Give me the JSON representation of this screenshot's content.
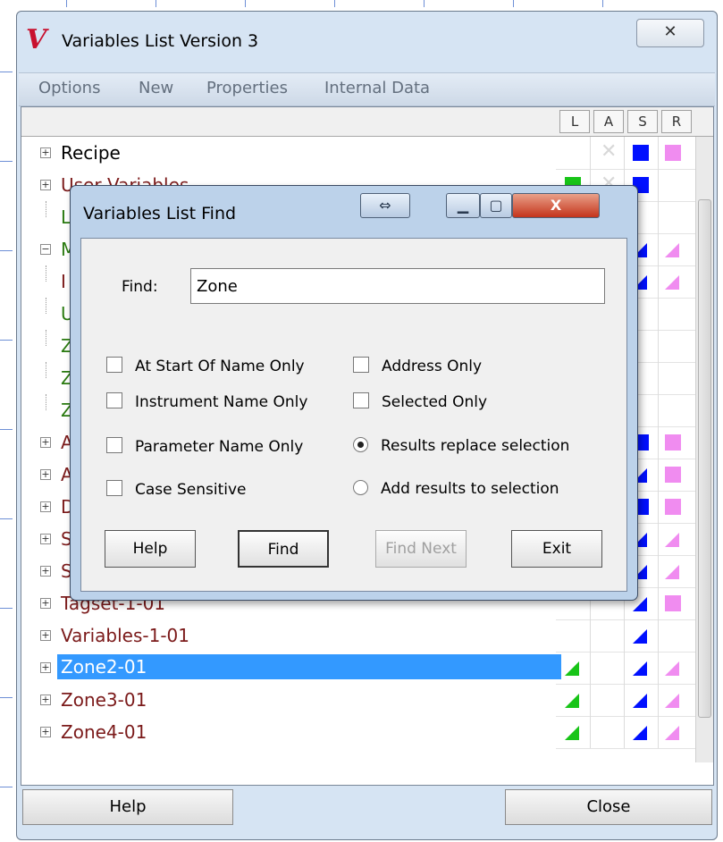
{
  "window": {
    "title": "Variables List Version 3",
    "logo": "V",
    "close_glyph": "✕"
  },
  "menu": [
    "Options",
    "New",
    "Properties",
    "Internal Data"
  ],
  "columns": [
    "L",
    "A",
    "S",
    "R"
  ],
  "tree_rows": [
    {
      "label": "Recipe",
      "color": "#000000"
    },
    {
      "label": "User Variables",
      "color": "#7b1a1a"
    },
    {
      "label": "L",
      "color": "#2a7a10"
    },
    {
      "label": "M",
      "color": "#2a7a10"
    },
    {
      "label": "I",
      "color": "#7b1a1a"
    },
    {
      "label": "U",
      "color": "#2a7a10"
    },
    {
      "label": "Z",
      "color": "#2a7a10"
    },
    {
      "label": "Z",
      "color": "#2a7a10"
    },
    {
      "label": "Z",
      "color": "#2a7a10"
    },
    {
      "label": "A",
      "color": "#7b1a1a"
    },
    {
      "label": "A",
      "color": "#7b1a1a"
    },
    {
      "label": "D",
      "color": "#7b1a1a"
    },
    {
      "label": "S",
      "color": "#7b1a1a"
    },
    {
      "label": "S",
      "color": "#7b1a1a"
    },
    {
      "label": "Tagset-1-01",
      "color": "#7b1a1a"
    },
    {
      "label": "Variables-1-01",
      "color": "#7b1a1a"
    },
    {
      "label": "Zone2-01",
      "color": "#ffffff"
    },
    {
      "label": "Zone3-01",
      "color": "#7b1a1a"
    },
    {
      "label": "Zone4-01",
      "color": "#7b1a1a"
    }
  ],
  "colors": {
    "blue": "#0010ff",
    "pink": "#f08cf0",
    "green": "#18c418",
    "selection": "#3399ff"
  },
  "find_dialog": {
    "title": "Variables List Find",
    "find_label": "Find:",
    "find_value": "Zone",
    "checkboxes": [
      "At Start Of Name Only",
      "Instrument Name Only",
      "Parameter Name Only",
      "Case Sensitive",
      "Address Only",
      "Selected Only"
    ],
    "radios": [
      "Results replace selection",
      "Add results to selection"
    ],
    "selected_radio": "Results replace selection",
    "buttons": {
      "help": "Help",
      "find": "Find",
      "find_next": "Find Next",
      "exit": "Exit"
    },
    "title_buttons": {
      "resize": "⇔",
      "minimize": "▁",
      "maximize": "▢",
      "close": "X"
    }
  },
  "footer": {
    "help": "Help",
    "close": "Close"
  }
}
